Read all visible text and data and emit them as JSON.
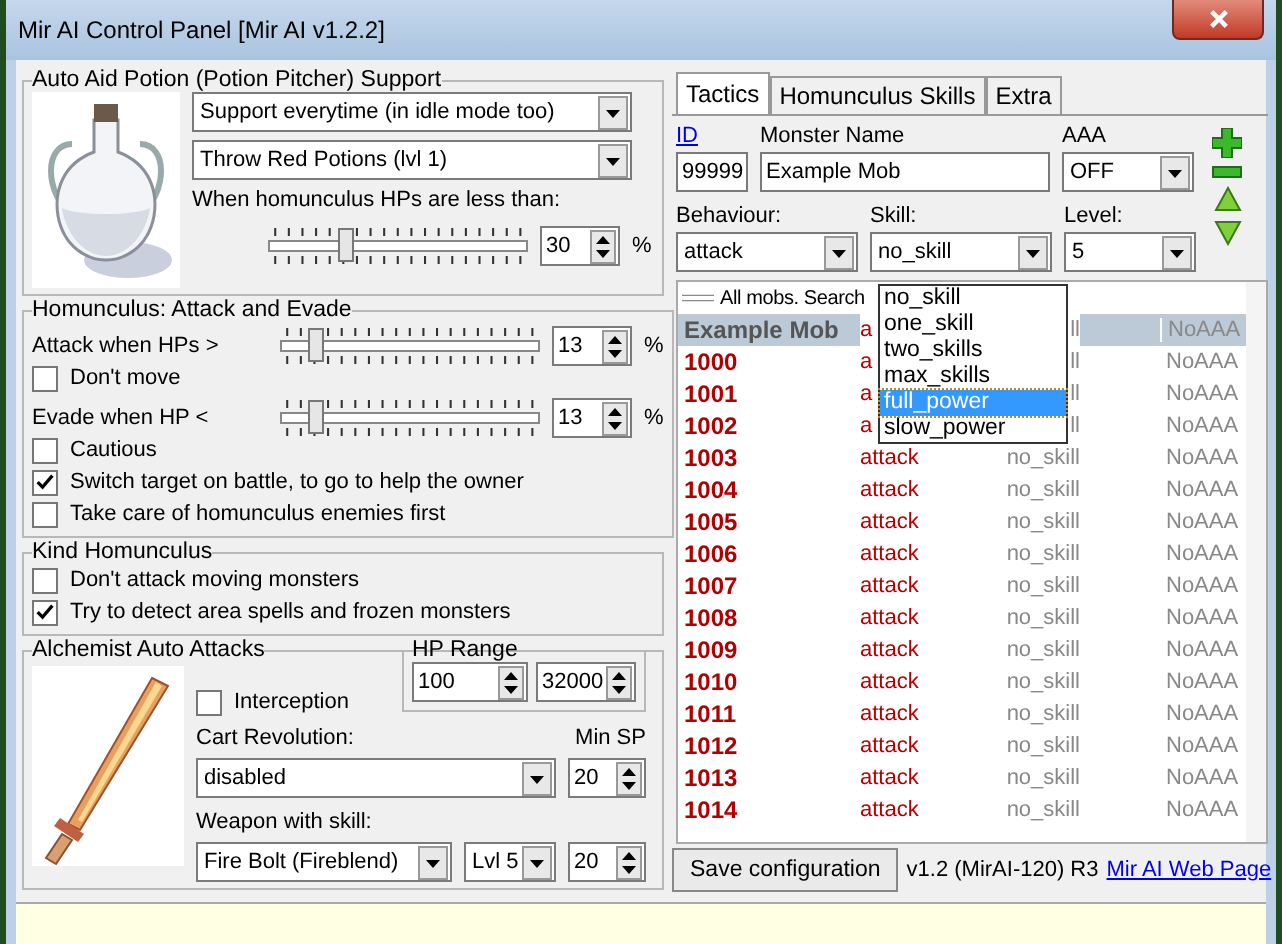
{
  "window": {
    "title": "Mir AI Control Panel [Mir AI v1.2.2]"
  },
  "potion_support": {
    "title": "Auto Aid Potion (Potion Pitcher) Support",
    "mode": "Support everytime (in idle mode too)",
    "potion": "Throw Red Potions (lvl 1)",
    "threshold_label": "When homunculus HPs are less than:",
    "threshold": {
      "level": 0.3,
      "value": "30",
      "unit": "%"
    }
  },
  "attack_evade": {
    "title": "Homunculus: Attack and Evade",
    "items": [
      {
        "kind": "slider",
        "label": "Attack when HPs >",
        "level": 0.13,
        "value": "13",
        "unit": "%"
      },
      {
        "kind": "checkbox",
        "label": "Don't move",
        "checked": false
      },
      {
        "kind": "slider",
        "label": "Evade when HP <",
        "level": 0.13,
        "value": "13",
        "unit": "%"
      },
      {
        "kind": "checkbox",
        "label": "Cautious",
        "checked": false
      },
      {
        "kind": "checkbox",
        "label": "Switch target on battle, to go to help the owner",
        "checked": true
      },
      {
        "kind": "checkbox",
        "label": "Take care of homunculus enemies first",
        "checked": false
      }
    ]
  },
  "kind_homunculus": {
    "title": "Kind Homunculus",
    "items": [
      {
        "label": "Don't attack moving monsters",
        "checked": false
      },
      {
        "label": "Try to detect area spells and frozen monsters",
        "checked": true
      }
    ]
  },
  "alchemist": {
    "title": "Alchemist Auto Attacks",
    "interception": {
      "label": "Interception",
      "checked": false
    },
    "hp_range": {
      "title": "HP Range",
      "min": "100",
      "max": "32000"
    },
    "cart_label": "Cart Revolution:",
    "cart": "disabled",
    "min_sp_label": "Min SP",
    "min_sp": "20",
    "weapon_label": "Weapon with skill:",
    "weapon_skill": "Fire Bolt (Fireblend)",
    "weapon_level": "Lvl 5",
    "weapon_sp": "20"
  },
  "tabs": [
    {
      "label": "Tactics",
      "selected": true
    },
    {
      "label": "Homunculus Skills",
      "selected": false
    },
    {
      "label": "Extra",
      "selected": false
    }
  ],
  "form": {
    "id_label": "ID",
    "id": "99999",
    "name_label": "Monster Name",
    "name": "Example Mob",
    "aaa_label": "AAA",
    "aaa": "OFF",
    "behaviour_label": "Behaviour:",
    "behaviour": "attack",
    "skill_label": "Skill:",
    "skill": "no_skill",
    "level_label": "Level:",
    "level_value": "5"
  },
  "skill_dropdown": [
    {
      "label": "no_skill",
      "selected": false
    },
    {
      "label": "one_skill",
      "selected": false
    },
    {
      "label": "two_skills",
      "selected": false
    },
    {
      "label": "max_skills",
      "selected": false
    },
    {
      "label": "full_power",
      "selected": true
    },
    {
      "label": "slow_power",
      "selected": false
    }
  ],
  "list": {
    "header": "All mobs. Search",
    "rows": [
      {
        "name": "Example Mob",
        "behaviour": "a",
        "skill": "ll",
        "aaa": "NoAAA",
        "selected": true
      },
      {
        "name": "1000",
        "behaviour": "a",
        "skill": "ll",
        "aaa": "NoAAA",
        "selected": false
      },
      {
        "name": "1001",
        "behaviour": "a",
        "skill": "ll",
        "aaa": "NoAAA",
        "selected": false
      },
      {
        "name": "1002",
        "behaviour": "a",
        "skill": "ll",
        "aaa": "NoAAA",
        "selected": false
      },
      {
        "name": "1003",
        "behaviour": "attack",
        "skill": "no_skill",
        "aaa": "NoAAA",
        "selected": false
      },
      {
        "name": "1004",
        "behaviour": "attack",
        "skill": "no_skill",
        "aaa": "NoAAA",
        "selected": false
      },
      {
        "name": "1005",
        "behaviour": "attack",
        "skill": "no_skill",
        "aaa": "NoAAA",
        "selected": false
      },
      {
        "name": "1006",
        "behaviour": "attack",
        "skill": "no_skill",
        "aaa": "NoAAA",
        "selected": false
      },
      {
        "name": "1007",
        "behaviour": "attack",
        "skill": "no_skill",
        "aaa": "NoAAA",
        "selected": false
      },
      {
        "name": "1008",
        "behaviour": "attack",
        "skill": "no_skill",
        "aaa": "NoAAA",
        "selected": false
      },
      {
        "name": "1009",
        "behaviour": "attack",
        "skill": "no_skill",
        "aaa": "NoAAA",
        "selected": false
      },
      {
        "name": "1010",
        "behaviour": "attack",
        "skill": "no_skill",
        "aaa": "NoAAA",
        "selected": false
      },
      {
        "name": "1011",
        "behaviour": "attack",
        "skill": "no_skill",
        "aaa": "NoAAA",
        "selected": false
      },
      {
        "name": "1012",
        "behaviour": "attack",
        "skill": "no_skill",
        "aaa": "NoAAA",
        "selected": false
      },
      {
        "name": "1013",
        "behaviour": "attack",
        "skill": "no_skill",
        "aaa": "NoAAA",
        "selected": false
      },
      {
        "name": "1014",
        "behaviour": "attack",
        "skill": "no_skill",
        "aaa": "NoAAA",
        "selected": false
      }
    ]
  },
  "footer": {
    "save": "Save configuration",
    "version": "v1.2 (MirAI-120) R3",
    "link": "Mir AI Web Page"
  }
}
